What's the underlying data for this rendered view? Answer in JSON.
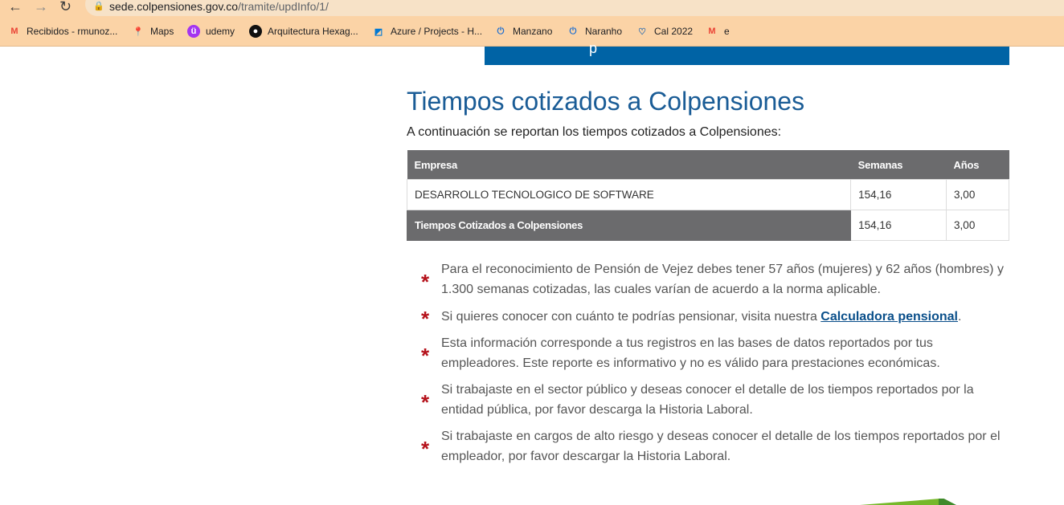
{
  "browser": {
    "url_host": "sede.colpensiones.gov.co",
    "url_path": "/tramite/updInfo/1/",
    "bookmarks": [
      {
        "label": "Recibidos - rmunoz...",
        "icon": "gmail-icon",
        "color": "#ea4335"
      },
      {
        "label": "Maps",
        "icon": "maps-pin-icon",
        "color": "#34a853"
      },
      {
        "label": "udemy",
        "icon": "udemy-icon",
        "color": "#a435f0"
      },
      {
        "label": "Arquitectura Hexag...",
        "icon": "circle-logo-icon",
        "color": "#111111"
      },
      {
        "label": "Azure / Projects - H...",
        "icon": "azure-devops-icon",
        "color": "#0078d4"
      },
      {
        "label": "Manzano",
        "icon": "power-icon",
        "color": "#1f6fd1"
      },
      {
        "label": "Naranho",
        "icon": "power-icon",
        "color": "#1f6fd1"
      },
      {
        "label": "Cal 2022",
        "icon": "shield-heart-icon",
        "color": "#2b6cb0"
      },
      {
        "label": "e",
        "icon": "gmail-icon",
        "color": "#ea4335"
      }
    ]
  },
  "page": {
    "title": "Tiempos cotizados a Colpensiones",
    "subtitle": "A continuación se reportan los tiempos cotizados a Colpensiones:",
    "table": {
      "headers": [
        "Empresa",
        "Semanas",
        "Años"
      ],
      "rows": [
        {
          "empresa": "DESARROLLO TECNOLOGICO DE SOFTWARE",
          "semanas": "154,16",
          "anos": "3,00"
        }
      ],
      "total": {
        "label": "Tiempos Cotizados a Colpensiones",
        "semanas": "154,16",
        "anos": "3,00"
      }
    },
    "notes": [
      {
        "text": "Para el reconocimiento de Pensión de Vejez debes tener 57 años (mujeres) y 62 años (hombres) y 1.300 semanas cotizadas, las cuales varían de acuerdo a la norma aplicable."
      },
      {
        "text_before": "Si quieres conocer con cuánto te podrías pensionar, visita nuestra ",
        "link": "Calculadora pensional",
        "text_after": "."
      },
      {
        "text": "Esta información corresponde a tus registros en las bases de datos reportados por tus empleadores. Este reporte es informativo y no es válido para prestaciones económicas."
      },
      {
        "text": "Si trabajaste en el sector público y deseas conocer el detalle de los tiempos reportados por la entidad pública, por favor descarga la Historia Laboral."
      },
      {
        "text": "Si trabajaste en cargos de alto riesgo y deseas conocer el detalle de los tiempos reportados por el empleador, por favor descargar la Historia Laboral."
      }
    ],
    "accent_color": "#0063a5",
    "note_marker_color": "#b5121b"
  }
}
